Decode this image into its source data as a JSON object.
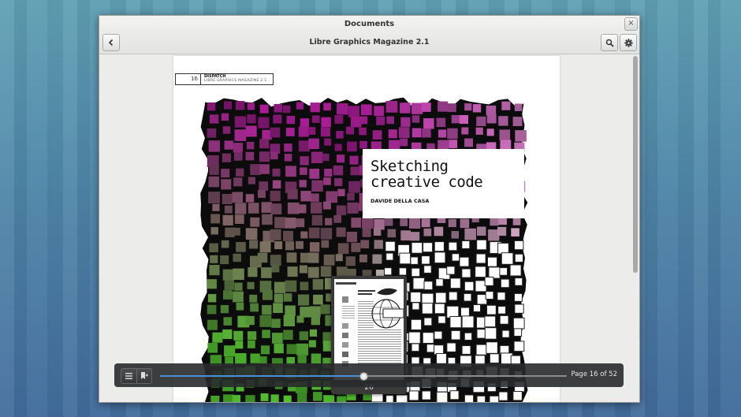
{
  "window": {
    "app_title": "Documents",
    "doc_title": "Libre Graphics Magazine 2.1",
    "close_glyph": "×",
    "back_icon": "back-arrow-icon",
    "search_icon": "search-icon",
    "settings_icon": "gear-icon"
  },
  "page": {
    "page_number": "16",
    "section": "DISPATCH",
    "magazine": "LIBRE GRAPHICS MAGAZINE 2.1",
    "article_title": "Sketching\ncreative code",
    "author": "DAVIDE DELLA CASA"
  },
  "preview": {
    "page_number": "26"
  },
  "navigation": {
    "page_label": "Page 16 of 52",
    "progress": 0.5,
    "current_page": 16,
    "total_pages": 52,
    "list_icon": "list-icon",
    "bookmark_icon": "bookmark-add-icon"
  },
  "colors": {
    "magenta": "#9b1a8a",
    "green": "#4caf2a",
    "accent": "#4a90d9"
  }
}
